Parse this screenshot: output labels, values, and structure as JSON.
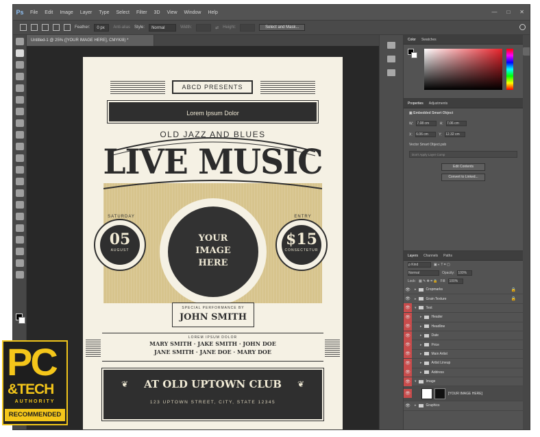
{
  "app": {
    "logo": "Ps",
    "menu": [
      "File",
      "Edit",
      "Image",
      "Layer",
      "Type",
      "Select",
      "Filter",
      "3D",
      "View",
      "Window",
      "Help"
    ],
    "window_controls": [
      "—",
      "□",
      "✕"
    ]
  },
  "options_bar": {
    "feather_label": "Feather:",
    "feather_value": "0 px",
    "antialias": "Anti-alias",
    "style_label": "Style:",
    "style_value": "Normal",
    "width_label": "Width:",
    "height_label": "Height:",
    "select_mask_button": "Select and Mask..."
  },
  "document": {
    "tab_title": "Untitled-1 @ 25% ([YOUR IMAGE HERE], CMYK/8) *"
  },
  "poster": {
    "abcd": "ABCD PRESENTS",
    "lorem": "Lorem Ipsum Dolor",
    "subtitle": "OLD JAZZ AND BLUES",
    "headline": "LIVE MUSIC",
    "date_arc": "SATURDAY",
    "date_num": "05",
    "date_month": "AUGUST",
    "price_arc": "ENTRY",
    "price": "$15",
    "price_sub": "CONSECTETUR",
    "image_line1": "YOUR",
    "image_line2": "IMAGE",
    "image_line3": "HERE",
    "special_label": "SPECIAL PERFORMANCE BY",
    "special_name": "JOHN SMITH",
    "names_label": "LOREM IPSUM DOLOR",
    "names_line1": "MARY SMITH · JAKE SMITH · JOHN DOE",
    "names_line2": "JANE SMITH · JANE DOE · MARY DOE",
    "club": "AT OLD UPTOWN CLUB",
    "address": "123 UPTOWN STREET, CITY, STATE 12345"
  },
  "color_panel": {
    "tabs": [
      "Color",
      "Swatches"
    ]
  },
  "properties_panel": {
    "tabs": [
      "Properties",
      "Adjustments"
    ],
    "object_type": "Embedded Smart Object",
    "w_label": "W:",
    "w_value": "7.08 cm",
    "h_label": "H:",
    "h_value": "7.06 cm",
    "x_label": "X:",
    "x_value": "6.06 cm",
    "y_label": "Y:",
    "y_value": "12.32 cm",
    "vector_label": "Vector Smart Object.psb",
    "comp_placeholder": "Don't Apply Layer Comp",
    "edit_button": "Edit Contents",
    "convert_button": "Convert to Linked..."
  },
  "layers_panel": {
    "tabs": [
      "Layers",
      "Channels",
      "Paths"
    ],
    "kind_label": "ρ Kind",
    "blend_mode": "Normal",
    "opacity_label": "Opacity:",
    "opacity_value": "100%",
    "lock_label": "Lock:",
    "fill_label": "Fill:",
    "fill_value": "100%",
    "layers": [
      {
        "name": "Cropmarks",
        "indent": 0,
        "locked": true,
        "red": false
      },
      {
        "name": "Grain Texture",
        "indent": 0,
        "locked": true,
        "red": false
      },
      {
        "name": "Text",
        "indent": 0,
        "locked": false,
        "red": true
      },
      {
        "name": "Header",
        "indent": 1,
        "locked": false,
        "red": true
      },
      {
        "name": "Headline",
        "indent": 1,
        "locked": false,
        "red": true
      },
      {
        "name": "Date",
        "indent": 1,
        "locked": false,
        "red": true
      },
      {
        "name": "Price",
        "indent": 1,
        "locked": false,
        "red": true
      },
      {
        "name": "Main Artist",
        "indent": 1,
        "locked": false,
        "red": true
      },
      {
        "name": "Artist Lineup",
        "indent": 1,
        "locked": false,
        "red": true
      },
      {
        "name": "Address",
        "indent": 1,
        "locked": false,
        "red": true
      },
      {
        "name": "Image",
        "indent": 0,
        "locked": false,
        "red": true
      },
      {
        "name": "[YOUR IMAGE HERE]",
        "indent": 1,
        "locked": false,
        "red": true
      },
      {
        "name": "Graphics",
        "indent": 0,
        "locked": false,
        "red": false
      }
    ]
  },
  "badge": {
    "pc": "PC",
    "tech": "&TECH",
    "authority": "AUTHORITY",
    "recommended": "RECOMMENDED"
  },
  "colors": {
    "panel_bg": "#535353",
    "poster_cream": "#f5f1e4",
    "poster_dark": "#2f2f2f",
    "poster_tan": "#d7c48d",
    "badge_yellow": "#f4c61a",
    "visibility_red": "#c84c4c"
  }
}
